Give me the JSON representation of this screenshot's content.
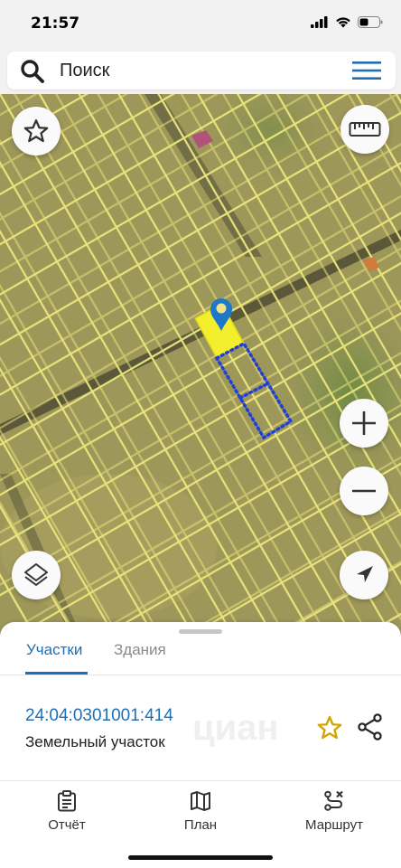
{
  "status": {
    "time": "21:57",
    "icons": [
      "signal-icon",
      "wifi-icon",
      "battery-icon"
    ]
  },
  "search": {
    "placeholder": "Поиск",
    "icon": "search-icon",
    "menu_icon": "hamburger-menu-icon"
  },
  "map": {
    "buttons": [
      "favorites-star",
      "ruler",
      "zoom-in",
      "zoom-out",
      "layers",
      "my-location"
    ],
    "colors": {
      "background": "#a39b5e",
      "parcel_lines": "#e8e37a",
      "selected_parcel": "#f3ef2c",
      "dotted_outline": "#1f3fd6",
      "marker": "#1e78c8"
    }
  },
  "sheet": {
    "tabs": [
      {
        "label": "Участки",
        "active": true
      },
      {
        "label": "Здания",
        "active": false
      }
    ],
    "parcel": {
      "number": "24:04:0301001:414",
      "type": "Земельный участок"
    },
    "watermark": "циан"
  },
  "nav": {
    "items": [
      {
        "label": "Отчёт",
        "icon": "report-clipboard-icon"
      },
      {
        "label": "План",
        "icon": "map-plan-icon"
      },
      {
        "label": "Маршрут",
        "icon": "route-icon"
      }
    ]
  },
  "colors": {
    "accent": "#1e6fb5",
    "star": "#d2a400"
  }
}
